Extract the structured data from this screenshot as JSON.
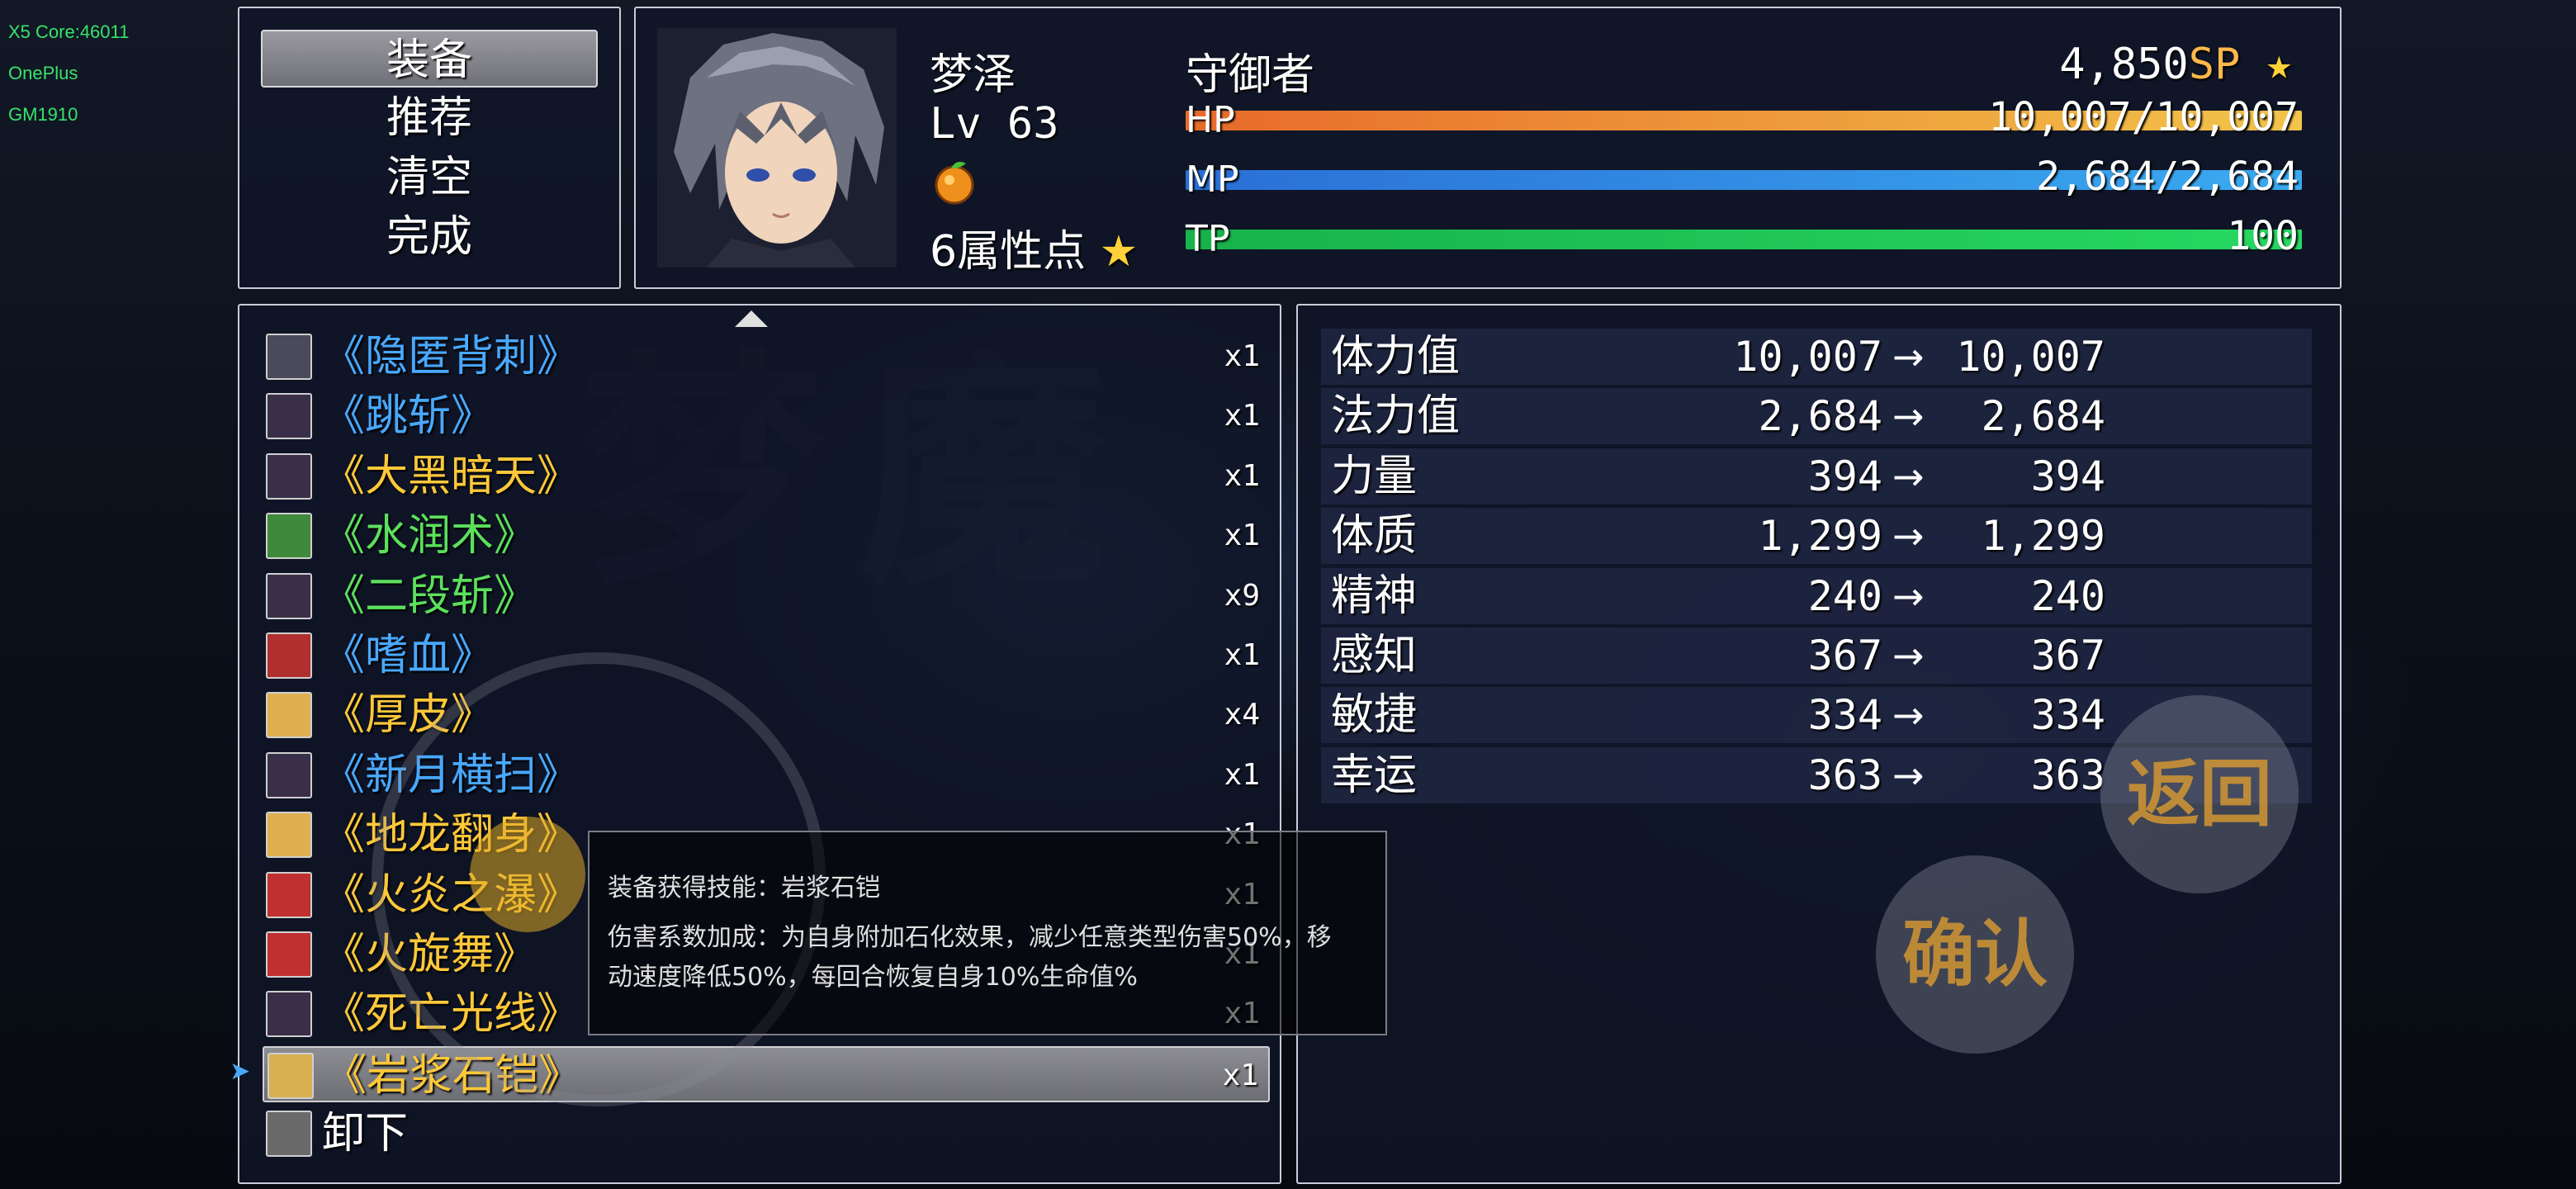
{
  "debug_overlay": [
    "X5 Core:46011",
    "OnePlus",
    "GM1910"
  ],
  "command_menu": {
    "items": [
      {
        "label": "装备",
        "selected": true
      },
      {
        "label": "推荐",
        "selected": false
      },
      {
        "label": "清空",
        "selected": false
      },
      {
        "label": "完成",
        "selected": false
      }
    ]
  },
  "actor": {
    "name": "梦泽",
    "level_label": "Lv 63",
    "class": "守御者",
    "sp": "4,850",
    "sp_unit": "SP",
    "attr_points": "6",
    "attr_points_label": "属性点",
    "hp_label": "HP",
    "hp": "10,007/10,007",
    "hp_fill": 1.0,
    "mp_label": "MP",
    "mp": "2,684/2,684",
    "mp_fill": 1.0,
    "tp_label": "TP",
    "tp": "100",
    "tp_fill": 1.0,
    "colors": {
      "hp": "#e9a63e",
      "mp": "#2f8fe0",
      "tp": "#1ec85a"
    }
  },
  "skill_list": [
    {
      "name": "《隐匿背刺》",
      "count": "x1",
      "color": "#49a8ff",
      "icon": "dagger-icon",
      "icon_bg": "#4a4a5a",
      "selected": false
    },
    {
      "name": "《跳斩》",
      "count": "x1",
      "color": "#49a8ff",
      "icon": "slash-icon",
      "icon_bg": "#3a2f48",
      "selected": false
    },
    {
      "name": "《大黑暗天》",
      "count": "x1",
      "color": "#ffc83a",
      "icon": "wing-icon",
      "icon_bg": "#3a2f48",
      "selected": false
    },
    {
      "name": "《水润术》",
      "count": "x1",
      "color": "#5ce05c",
      "icon": "cross-icon",
      "icon_bg": "#3f8a3a",
      "selected": false
    },
    {
      "name": "《二段斩》",
      "count": "x9",
      "color": "#5ce05c",
      "icon": "crescent-icon",
      "icon_bg": "#3a2f48",
      "selected": false
    },
    {
      "name": "《嗜血》",
      "count": "x1",
      "color": "#49a8ff",
      "icon": "blood-sword-icon",
      "icon_bg": "#b03030",
      "selected": false
    },
    {
      "name": "《厚皮》",
      "count": "x4",
      "color": "#ffc83a",
      "icon": "armor-icon",
      "icon_bg": "#e0b050",
      "selected": false
    },
    {
      "name": "《新月横扫》",
      "count": "x1",
      "color": "#49a8ff",
      "icon": "slash-icon",
      "icon_bg": "#3a2f48",
      "selected": false
    },
    {
      "name": "《地龙翻身》",
      "count": "x1",
      "color": "#ffc83a",
      "icon": "dragon-icon",
      "icon_bg": "#e0b050",
      "selected": false
    },
    {
      "name": "《火炎之瀑》",
      "count": "x1",
      "color": "#ffc83a",
      "icon": "fire-icon",
      "icon_bg": "#c03030",
      "selected": false
    },
    {
      "name": "《火旋舞》",
      "count": "x1",
      "color": "#ffc83a",
      "icon": "fire-spiral-icon",
      "icon_bg": "#c03030",
      "selected": false
    },
    {
      "name": "《死亡光线》",
      "count": "x1",
      "color": "#ffc83a",
      "icon": "crescent-icon",
      "icon_bg": "#3a2f48",
      "selected": false
    },
    {
      "name": "《岩浆石铠》",
      "count": "x1",
      "color": "#ffc83a",
      "icon": "shield-icon",
      "icon_bg": "#d8b050",
      "selected": true
    },
    {
      "name": "卸下",
      "count": "",
      "color": "#ffffff",
      "icon": "empty-slot-icon",
      "icon_bg": "#6a6a6a",
      "selected": false
    }
  ],
  "params": [
    {
      "name": "体力值",
      "current": "10,007",
      "new": "10,007"
    },
    {
      "name": "法力值",
      "current": "2,684",
      "new": "2,684"
    },
    {
      "name": "力量",
      "current": "394",
      "new": "394"
    },
    {
      "name": "体质",
      "current": "1,299",
      "new": "1,299"
    },
    {
      "name": "精神",
      "current": "240",
      "new": "240"
    },
    {
      "name": "感知",
      "current": "367",
      "new": "367"
    },
    {
      "name": "敏捷",
      "current": "334",
      "new": "334"
    },
    {
      "name": "幸运",
      "current": "363",
      "new": "363"
    }
  ],
  "param_arrow": "→",
  "tooltip": {
    "line1": "装备获得技能：岩浆石铠",
    "line2": "伤害系数加成：为自身附加石化效果，减少任意类型伤害50%，移",
    "line3": "动速度降低50%，每回合恢复自身10%生命值%"
  },
  "buttons": {
    "back": "返回",
    "confirm": "确认"
  },
  "background_title": "梦魔"
}
